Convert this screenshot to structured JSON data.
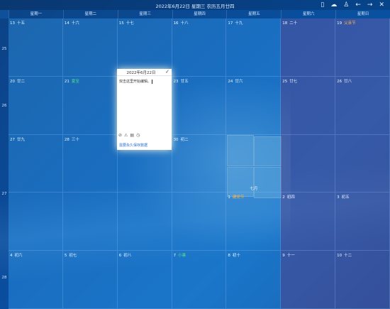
{
  "title": "2022年6月22日 星期三 农历五月廿四",
  "toolbar_icons": [
    "phone-icon",
    "cloud-icon",
    "user-icon",
    "back-icon",
    "forward-icon",
    "close-icon"
  ],
  "toolbar_glyphs": [
    "▯",
    "☁",
    "♙",
    "←",
    "→",
    "✕"
  ],
  "weekdays": [
    "星期一",
    "星期二",
    "星期三",
    "星期四",
    "星期五",
    "星期六",
    "星期日"
  ],
  "week_numbers": [
    "25",
    "26",
    "27",
    "28"
  ],
  "rows": [
    [
      {
        "day": "13",
        "lunar": "十五"
      },
      {
        "day": "14",
        "lunar": "十六"
      },
      {
        "day": "15",
        "lunar": "十七"
      },
      {
        "day": "16",
        "lunar": "十八"
      },
      {
        "day": "17",
        "lunar": "十九"
      },
      {
        "day": "18",
        "lunar": "二十"
      },
      {
        "day": "19",
        "lunar": "父亲节",
        "lunar_color": "orange"
      }
    ],
    [
      {
        "day": "20",
        "lunar": "廿二"
      },
      {
        "day": "21",
        "lunar": "夏至",
        "lunar_color": "green"
      },
      {
        "day": "22",
        "lunar": ""
      },
      {
        "day": "23",
        "lunar": "廿五"
      },
      {
        "day": "24",
        "lunar": "廿六"
      },
      {
        "day": "25",
        "lunar": "廿七"
      },
      {
        "day": "26",
        "lunar": "廿八"
      }
    ],
    [
      {
        "day": "27",
        "lunar": "廿九"
      },
      {
        "day": "28",
        "lunar": "三十"
      },
      {
        "day": "29",
        "lunar": ""
      },
      {
        "day": "30",
        "lunar": "初二"
      },
      {
        "day": "",
        "lunar": ""
      },
      {
        "day": "",
        "lunar": ""
      },
      {
        "day": "",
        "lunar": ""
      }
    ],
    [
      {
        "day": "",
        "lunar": ""
      },
      {
        "day": "",
        "lunar": ""
      },
      {
        "day": "",
        "lunar": ""
      },
      {
        "day": "",
        "lunar": ""
      },
      {
        "day": "1",
        "lunar": "建党节",
        "lunar_color": "orange"
      },
      {
        "day": "2",
        "lunar": "初四"
      },
      {
        "day": "3",
        "lunar": "初五"
      }
    ],
    [
      {
        "day": "4",
        "lunar": "初六"
      },
      {
        "day": "5",
        "lunar": "初七"
      },
      {
        "day": "6",
        "lunar": "初八"
      },
      {
        "day": "7",
        "lunar": "小暑",
        "lunar_color": "green"
      },
      {
        "day": "8",
        "lunar": "初十"
      },
      {
        "day": "9",
        "lunar": "十一"
      },
      {
        "day": "10",
        "lunar": "十二"
      }
    ]
  ],
  "month_label": "七月",
  "note": {
    "date": "2022年6月22日",
    "confirm_glyph": "✓",
    "text": "双击这里开始编辑。",
    "tools": [
      "⊘",
      "⚠",
      "▤",
      "◷"
    ],
    "tool_names": [
      "clear-icon",
      "warning-icon",
      "document-icon",
      "clock-icon"
    ],
    "link": "需要永久保存数据"
  }
}
